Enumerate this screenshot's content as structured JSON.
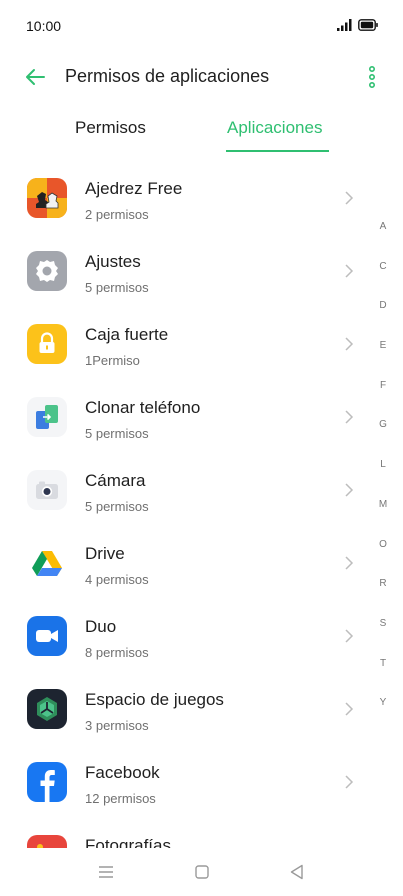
{
  "status_bar": {
    "time": "10:00",
    "signal_icon": "signal-bars-icon",
    "battery_icon": "battery-icon"
  },
  "header": {
    "title": "Permisos de aplicaciones",
    "back_icon": "arrow-left-icon",
    "more_icon": "more-vertical-icon"
  },
  "colors": {
    "accent": "#2fbf71",
    "text": "#1f1f1f",
    "secondary": "#707070"
  },
  "tabs": [
    {
      "label": "Permisos",
      "active": false
    },
    {
      "label": "Aplicaciones",
      "active": true
    }
  ],
  "apps": [
    {
      "name": "Ajedrez Free",
      "permissions": "2 permisos",
      "icon": "chess-icon"
    },
    {
      "name": "Ajustes",
      "permissions": "5 permisos",
      "icon": "gear-icon"
    },
    {
      "name": "Caja fuerte",
      "permissions": "1Permiso",
      "icon": "lock-icon"
    },
    {
      "name": "Clonar teléfono",
      "permissions": "5 permisos",
      "icon": "phone-clone-icon"
    },
    {
      "name": "Cámara",
      "permissions": "5 permisos",
      "icon": "camera-icon"
    },
    {
      "name": "Drive",
      "permissions": "4 permisos",
      "icon": "drive-icon"
    },
    {
      "name": "Duo",
      "permissions": "8 permisos",
      "icon": "video-icon"
    },
    {
      "name": "Espacio de juegos",
      "permissions": "3 permisos",
      "icon": "game-space-icon"
    },
    {
      "name": "Facebook",
      "permissions": "12 permisos",
      "icon": "facebook-icon"
    },
    {
      "name": "Fotografías",
      "permissions": "",
      "icon": "photos-icon"
    }
  ],
  "alpha_index": [
    "A",
    "C",
    "D",
    "E",
    "F",
    "G",
    "L",
    "M",
    "O",
    "R",
    "S",
    "T",
    "Y"
  ],
  "nav_bar": {
    "menu_icon": "menu-icon",
    "home_icon": "home-icon",
    "back_icon": "back-triangle-icon"
  }
}
